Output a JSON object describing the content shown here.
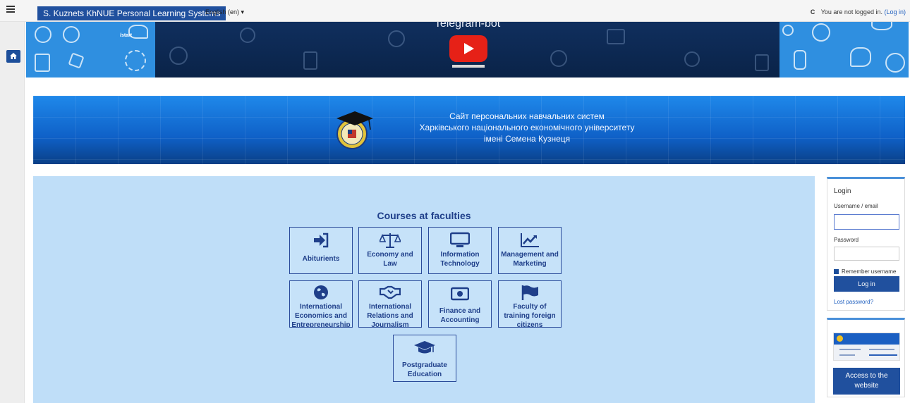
{
  "navbar": {
    "brand": "S. Kuznets KhNUE Personal Learning Systems",
    "language": "English (en) ▾",
    "status_prefix": "C",
    "not_logged": "You are not logged in.",
    "login_link": "(Log in)"
  },
  "video": {
    "title": "Telegram-bot",
    "start_label": "/start"
  },
  "university": {
    "line1": "Сайт персональних навчальних систем",
    "line2": "Харківського національного економічного університету",
    "line3": "імені Семена Кузнеця"
  },
  "courses": {
    "title": "Courses at faculties",
    "tiles": [
      {
        "label": "Abiturients",
        "icon": "sign-in-icon"
      },
      {
        "label": "Economy and Law",
        "icon": "balance-scale-icon"
      },
      {
        "label": "Information Technology",
        "icon": "monitor-icon"
      },
      {
        "label": "Management and Marketing",
        "icon": "line-chart-icon"
      },
      {
        "label": "International Economics and Entrepreneurship",
        "icon": "globe-icon"
      },
      {
        "label": "International Relations and Journalism",
        "icon": "handshake-icon"
      },
      {
        "label": "Finance and Accounting",
        "icon": "money-icon"
      },
      {
        "label": "Faculty of training foreign citizens",
        "icon": "flag-icon"
      },
      {
        "label": "Postgraduate Education",
        "icon": "graduation-cap-icon"
      }
    ]
  },
  "login": {
    "title": "Login",
    "username_label": "Username / email",
    "username_value": "",
    "password_label": "Password",
    "password_value": "",
    "remember": "Remember username",
    "submit": "Log in",
    "lost": "Lost password?"
  },
  "site_block": {
    "button": "Access to the website"
  },
  "colors": {
    "brand": "#20509e",
    "panel": "#bfdef8",
    "tile_text": "#1f3f8a",
    "youtube": "#e62117"
  }
}
